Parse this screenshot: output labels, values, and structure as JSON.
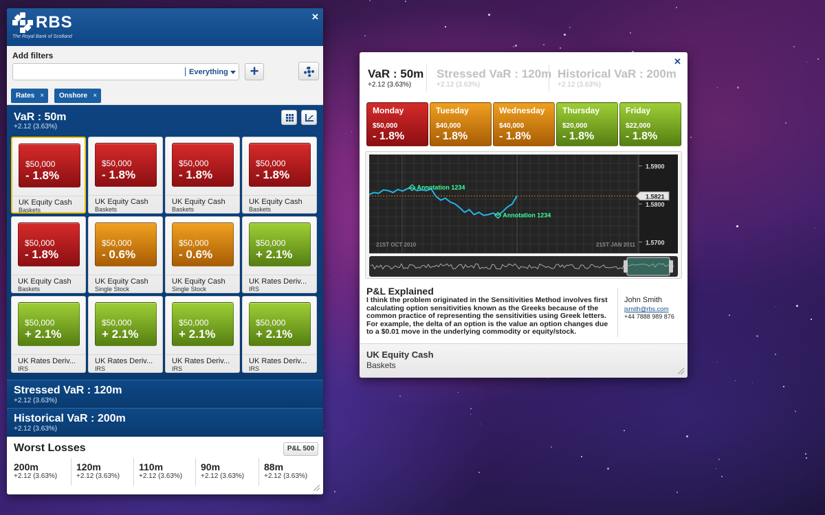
{
  "brand": {
    "name": "RBS",
    "tagline": "The Royal Bank of Scotland"
  },
  "filters": {
    "label": "Add filters",
    "input_value": "",
    "scope": "Everything",
    "chips": [
      {
        "label": "Rates",
        "remove": "×"
      },
      {
        "label": "Onshore",
        "remove": "×"
      }
    ]
  },
  "var": {
    "title": "VaR : 50m",
    "change": "+2.12 (3.63%)",
    "tiles": [
      {
        "amount": "$50,000",
        "pct": "- 1.8%",
        "name": "UK Equity Cash",
        "type": "Baskets",
        "color": "red"
      },
      {
        "amount": "$50,000",
        "pct": "- 1.8%",
        "name": "UK Equity Cash",
        "type": "Baskets",
        "color": "red"
      },
      {
        "amount": "$50,000",
        "pct": "- 1.8%",
        "name": "UK Equity Cash",
        "type": "Baskets",
        "color": "red"
      },
      {
        "amount": "$50,000",
        "pct": "- 1.8%",
        "name": "UK Equity Cash",
        "type": "Baskets",
        "color": "red"
      },
      {
        "amount": "$50,000",
        "pct": "- 1.8%",
        "name": "UK Equity Cash",
        "type": "Baskets",
        "color": "red"
      },
      {
        "amount": "$50,000",
        "pct": "- 0.6%",
        "name": "UK Equity Cash",
        "type": "Single Stock",
        "color": "orange"
      },
      {
        "amount": "$50,000",
        "pct": "- 0.6%",
        "name": "UK Equity Cash",
        "type": "Single Stock",
        "color": "orange"
      },
      {
        "amount": "$50,000",
        "pct": "+ 2.1%",
        "name": "UK Rates Deriv...",
        "type": "IRS",
        "color": "green"
      },
      {
        "amount": "$50,000",
        "pct": "+ 2.1%",
        "name": "UK Rates Deriv...",
        "type": "IRS",
        "color": "green"
      },
      {
        "amount": "$50,000",
        "pct": "+ 2.1%",
        "name": "UK Rates Deriv...",
        "type": "IRS",
        "color": "green"
      },
      {
        "amount": "$50,000",
        "pct": "+ 2.1%",
        "name": "UK Rates Deriv...",
        "type": "IRS",
        "color": "green"
      },
      {
        "amount": "$50,000",
        "pct": "+ 2.1%",
        "name": "UK Rates Deriv...",
        "type": "IRS",
        "color": "green"
      }
    ]
  },
  "stressed": {
    "title": "Stressed VaR : 120m",
    "change": "+2.12 (3.63%)"
  },
  "historical": {
    "title": "Historical VaR : 200m",
    "change": "+2.12 (3.63%)"
  },
  "worst_losses": {
    "title": "Worst Losses",
    "button": "P&L 500",
    "items": [
      {
        "value": "200m",
        "change": "+2.12 (3.63%)"
      },
      {
        "value": "120m",
        "change": "+2.12 (3.63%)"
      },
      {
        "value": "110m",
        "change": "+2.12 (3.63%)"
      },
      {
        "value": "90m",
        "change": "+2.12 (3.63%)"
      },
      {
        "value": "88m",
        "change": "+2.12 (3.63%)"
      }
    ]
  },
  "detail": {
    "metrics": [
      {
        "title": "VaR : 50m",
        "change": "+2.12 (3.63%)"
      },
      {
        "title": "Stressed VaR : 120m",
        "change": "+2.12 (3.63%)"
      },
      {
        "title": "Historical VaR : 200m",
        "change": "+2.12 (3.63%)"
      }
    ],
    "days": [
      {
        "name": "Monday",
        "amount": "$50,000",
        "pct": "- 1.8%",
        "color": "red"
      },
      {
        "name": "Tuesday",
        "amount": "$40,000",
        "pct": "- 1.8%",
        "color": "orange"
      },
      {
        "name": "Wednesday",
        "amount": "$40,000",
        "pct": "- 1.8%",
        "color": "orange"
      },
      {
        "name": "Thursday",
        "amount": "$20,000",
        "pct": "- 1.8%",
        "color": "green"
      },
      {
        "name": "Friday",
        "amount": "$22,000",
        "pct": "- 1.8%",
        "color": "green"
      }
    ],
    "pl": {
      "title": "P&L Explained",
      "text": "I think the problem originated in the Sensitivities Method involves first calculating option sensitivities known as the Greeks because of the common practice of representing the sensitivities using Greek letters. For example, the delta of an option is the value an option changes due to a $0.01 move in the underlying commodity or equity/stock."
    },
    "contact": {
      "name": "John Smith",
      "email": "jsmith@rbs.com",
      "phone": "+44 7888 989 876"
    },
    "footer": {
      "title": "UK Equity Cash",
      "subtitle": "Baskets"
    }
  },
  "chart_data": {
    "type": "line",
    "y_ticks": [
      "1.5900",
      "1.5800",
      "1.5700"
    ],
    "ylim": [
      1.567,
      1.593
    ],
    "x_labels": [
      "21ST OCT 2010",
      "21ST JAN 2011"
    ],
    "current_value": "1.5821",
    "annotations": [
      {
        "label": "Annotation 1234",
        "index": 9
      },
      {
        "label": "Annotation 1234",
        "index": 27
      }
    ],
    "series": [
      {
        "values": [
          1.5825,
          1.583,
          1.5828,
          1.5837,
          1.5835,
          1.583,
          1.5838,
          1.5834,
          1.584,
          1.5843,
          1.5835,
          1.5837,
          1.5835,
          1.584,
          1.582,
          1.581,
          1.5815,
          1.5805,
          1.58,
          1.579,
          1.5778,
          1.5785,
          1.5772,
          1.5778,
          1.577,
          1.5772,
          1.5776,
          1.577,
          1.578,
          1.5792,
          1.58,
          1.5821
        ]
      }
    ]
  }
}
